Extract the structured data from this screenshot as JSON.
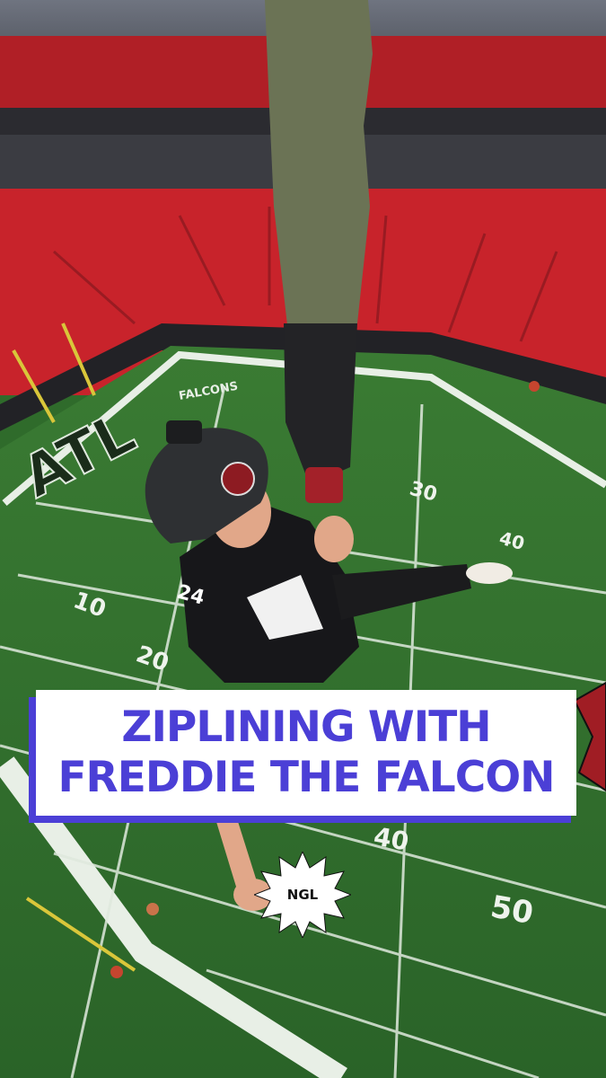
{
  "caption": {
    "line1": "ZIPLINING WITH",
    "line2": "FREDDIE THE FALCON"
  },
  "badge": {
    "label": "NGL"
  },
  "field": {
    "end_zone_text": "ATL",
    "sideline_text": "FALCONS",
    "yard_numbers": [
      "10",
      "20",
      "30",
      "40",
      "50",
      "40"
    ]
  },
  "rider": {
    "jersey_number": "24"
  },
  "colors": {
    "accent": "#4b3fd6",
    "caption_bg": "#ffffff",
    "turf": "#2f6b2b",
    "seats": "#c8232b"
  }
}
